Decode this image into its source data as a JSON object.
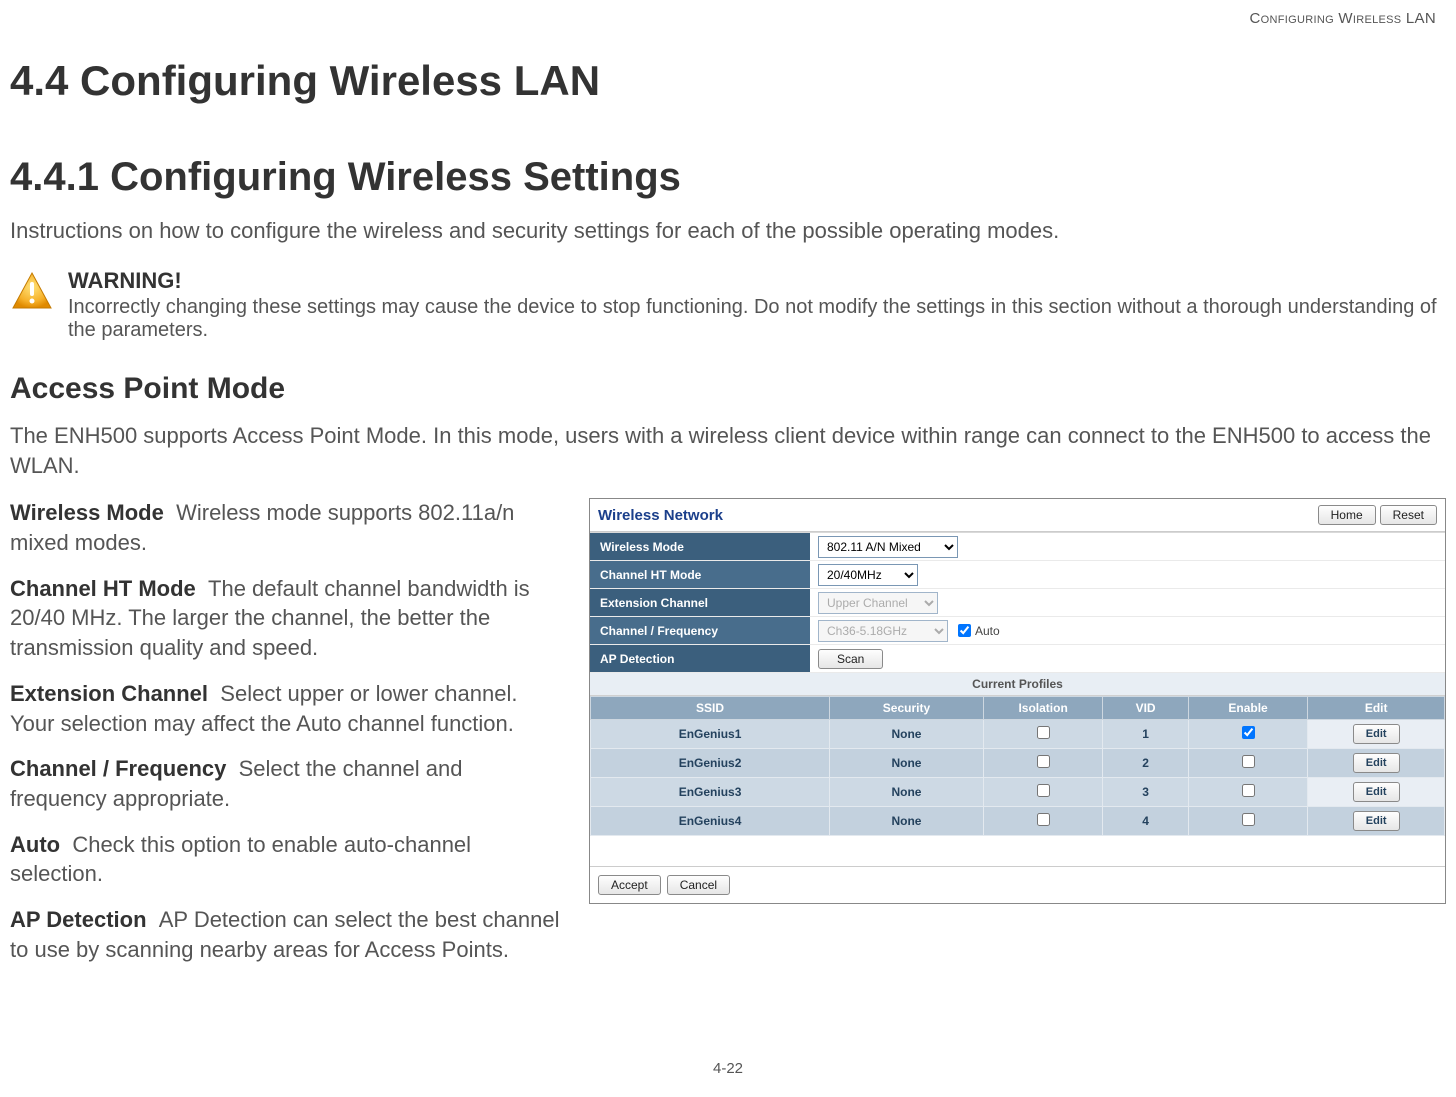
{
  "running_head": "Configuring Wireless LAN",
  "section_h1": "4.4 Configuring Wireless LAN",
  "section_h2": "4.4.1 Configuring Wireless Settings",
  "intro": "Instructions on how to configure the wireless and security settings for each of the possible operating modes.",
  "warning": {
    "title": "WARNING!",
    "body": "Incorrectly changing these settings may cause the device to stop functioning. Do not modify the settings in this section without a thorough understanding of the parameters."
  },
  "section_h3": "Access Point Mode",
  "ap_intro": "The ENH500 supports Access Point Mode. In this mode, users with a wireless client device within range can connect to the ENH500 to access the WLAN.",
  "definitions": [
    {
      "term": "Wireless Mode",
      "body": "Wireless mode supports 802.11a/n mixed modes."
    },
    {
      "term": "Channel HT Mode",
      "body": "The default channel bandwidth is 20/40 MHz. The larger the channel, the better the transmission quality and speed."
    },
    {
      "term": "Extension Channel",
      "body": "Select upper or lower channel. Your selection may affect the Auto channel function."
    },
    {
      "term": "Channel / Frequency",
      "body": "Select the channel and frequency appropriate."
    },
    {
      "term": "Auto",
      "body": "Check this option to enable auto-channel selection."
    },
    {
      "term": "AP Detection",
      "body": "AP Detection can select the best channel to use by scanning nearby areas for Access Points."
    }
  ],
  "screenshot": {
    "panel_title": "Wireless Network",
    "top_buttons": {
      "home": "Home",
      "reset": "Reset"
    },
    "rows": {
      "wireless_mode": {
        "label": "Wireless Mode",
        "value": "802.11 A/N Mixed"
      },
      "channel_ht_mode": {
        "label": "Channel HT Mode",
        "value": "20/40MHz"
      },
      "extension_channel": {
        "label": "Extension Channel",
        "value": "Upper Channel"
      },
      "channel_frequency": {
        "label": "Channel / Frequency",
        "value": "Ch36-5.18GHz",
        "auto_label": "Auto"
      },
      "ap_detection": {
        "label": "AP Detection",
        "button": "Scan"
      }
    },
    "profiles_header": "Current Profiles",
    "columns": {
      "ssid": "SSID",
      "security": "Security",
      "isolation": "Isolation",
      "vid": "VID",
      "enable": "Enable",
      "edit": "Edit"
    },
    "profiles": [
      {
        "ssid": "EnGenius1",
        "security": "None",
        "isolation": false,
        "vid": "1",
        "enable": true
      },
      {
        "ssid": "EnGenius2",
        "security": "None",
        "isolation": false,
        "vid": "2",
        "enable": false
      },
      {
        "ssid": "EnGenius3",
        "security": "None",
        "isolation": false,
        "vid": "3",
        "enable": false
      },
      {
        "ssid": "EnGenius4",
        "security": "None",
        "isolation": false,
        "vid": "4",
        "enable": false
      }
    ],
    "edit_button": "Edit",
    "footer": {
      "accept": "Accept",
      "cancel": "Cancel"
    }
  },
  "page_number": "4-22"
}
